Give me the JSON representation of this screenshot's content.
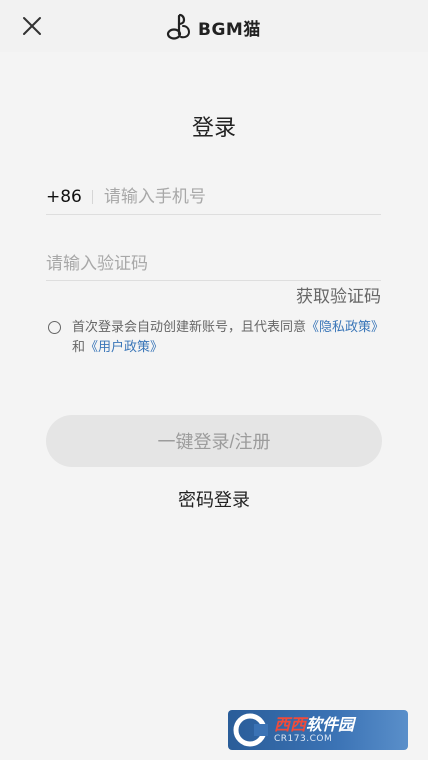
{
  "header": {
    "brand_name": "BGM猫",
    "close_icon": "close-icon",
    "brand_icon": "music-note-logo-icon"
  },
  "login": {
    "title": "登录",
    "country_code": "+86",
    "phone_placeholder": "请输入手机号",
    "code_placeholder": "请输入验证码",
    "get_code_label": "获取验证码",
    "agreement_prefix": "首次登录会自动创建新账号，且代表同意",
    "privacy_link": "《隐私政策》",
    "agreement_and": "和",
    "user_link": "《用户政策》",
    "agreement_checked": false,
    "submit_label": "一键登录/注册",
    "password_login_label": "密码登录"
  },
  "watermark": {
    "main_red": "西西",
    "main_white": "软件园",
    "sub": "CR173.COM"
  },
  "colors": {
    "background": "#f4f4f4",
    "link": "#3a76b8",
    "button_disabled_bg": "#e5e5e5",
    "button_disabled_text": "#9c9c9c"
  }
}
